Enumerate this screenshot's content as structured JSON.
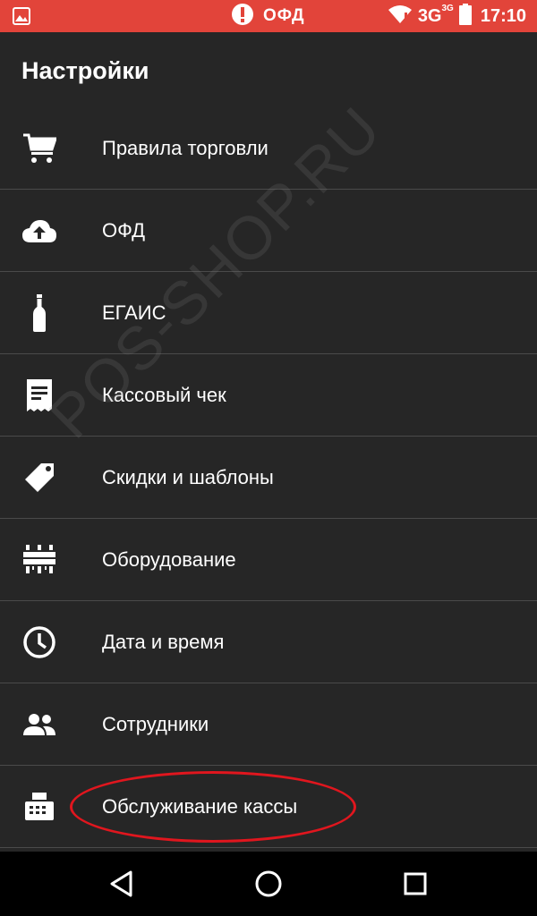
{
  "status_bar": {
    "ofd_text": "ОФД",
    "network": "3G",
    "network_sup": "3G",
    "time": "17:10",
    "bg_color": "#e2443a"
  },
  "app_bar": {
    "title": "Настройки"
  },
  "menu": {
    "items": [
      {
        "label": "Правила торговли",
        "icon": "cart-icon"
      },
      {
        "label": "ОФД",
        "icon": "cloud-upload-icon"
      },
      {
        "label": "ЕГАИС",
        "icon": "bottle-icon"
      },
      {
        "label": "Кассовый чек",
        "icon": "receipt-icon"
      },
      {
        "label": "Скидки и шаблоны",
        "icon": "tag-icon"
      },
      {
        "label": "Оборудование",
        "icon": "equipment-icon"
      },
      {
        "label": "Дата и время",
        "icon": "clock-icon"
      },
      {
        "label": "Сотрудники",
        "icon": "people-icon"
      },
      {
        "label": "Обслуживание кассы",
        "icon": "cash-register-icon"
      }
    ]
  },
  "watermark": "POS-SHOP.RU",
  "colors": {
    "background": "#262626",
    "divider": "#4a4a4a",
    "highlight": "#e0161e"
  }
}
